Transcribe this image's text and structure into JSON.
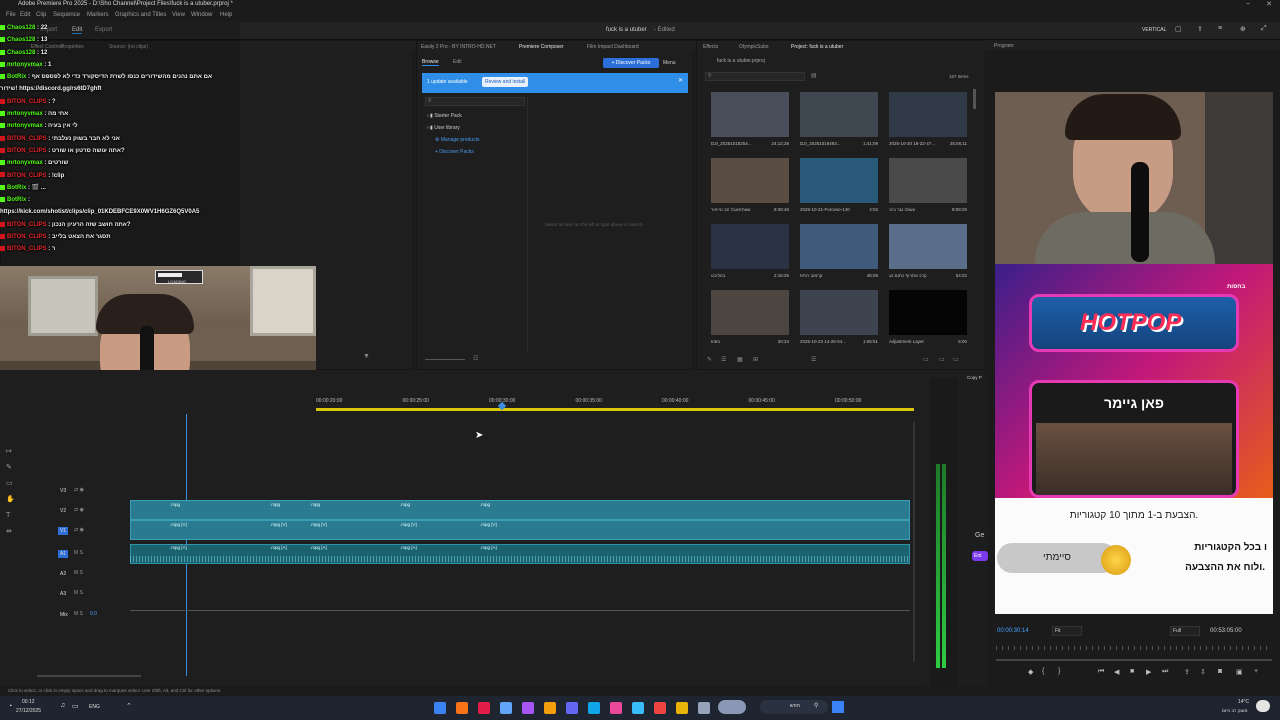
{
  "app": {
    "title_line": "Adobe Premiere Pro 2025 - D:\\Sho Channel\\Project Files\\fuck is a utuber.prproj *",
    "project_title": "fuck is a utuber",
    "edited_status": "- Edited",
    "layout_label": "VERTICAL"
  },
  "menu": [
    "File",
    "Edit",
    "Clip",
    "Sequence",
    "Markers",
    "Graphics and Titles",
    "View",
    "Window",
    "Help"
  ],
  "workspace_tabs": [
    "Import",
    "Edit",
    "Export"
  ],
  "source_panel": {
    "tabs": [
      "Effect Controls",
      "Properties",
      "Source: (no clips)"
    ],
    "clip_state": "(no clip selected)"
  },
  "premiere_composer": {
    "tabs": [
      "Easily 2 Pro - BY INTRO-HD.NET",
      "Premiere Composer",
      "Film Impact Dashboard"
    ],
    "sub_tabs": [
      "Browse",
      "Edit"
    ],
    "discover_button": "+ Discover Packs",
    "menu_button": "Menu",
    "update_text": "1 update available",
    "review_button": "Review and install",
    "tree": [
      "Starter Pack",
      "User library",
      "Manage products",
      "+ Discover Packs"
    ],
    "empty_hint": "Select an item on the left or type above to search"
  },
  "project_panel": {
    "tabs": [
      "Effects",
      "OlympicSubs",
      "Project: fuck is a utuber"
    ],
    "file": "fuck is a utuber.prproj",
    "items_count": "167 items",
    "items": [
      {
        "name": "DJI_20251018254...",
        "dur": "24;12;28"
      },
      {
        "name": "DJI_20251018493...",
        "dur": "1;41;09"
      },
      {
        "name": "2025-10-20 18-22-47...",
        "dur": "25;56;11"
      },
      {
        "name": "עשתחאבל הב ונייחור",
        "dur": "8:36:46"
      },
      {
        "name": "2025-10-21-Forcese-140...",
        "dur": "4:02"
      },
      {
        "name": "עשולו גגר ביגי",
        "dur": "8:08:25"
      },
      {
        "name": "בזוליבט",
        "dur": "2:16:26"
      },
      {
        "name": "קרמוב רוחפ",
        "dur": "48:09"
      },
      {
        "name": "קרב אתרוף כתום נע",
        "dur": "54:22"
      },
      {
        "name": "Intro",
        "dur": "30:34"
      },
      {
        "name": "2025-10-23 14-26-54...",
        "dur": "1:05:51"
      },
      {
        "name": "Adjustment Layer",
        "dur": "5:00"
      }
    ]
  },
  "chat": [
    {
      "user": "Chaos128",
      "msg": " : 22",
      "red": false
    },
    {
      "user": "Chaos128",
      "msg": " : 13",
      "red": false
    },
    {
      "user": "Chaos128",
      "msg": " : 12",
      "red": false
    },
    {
      "user": "mrtonyvmax",
      "msg": " : 1",
      "red": false
    },
    {
      "user": "BotRix",
      "msg": " : אם אתם נהנים מהשידורים כנסו לשרת הדיסקורד כדי לא לפספס אף",
      "red": false
    },
    {
      "user": "",
      "msg": "שידור! https://discord.gg/rs6tD7ghft",
      "red": false
    },
    {
      "user": "BITON_CLIPS",
      "msg": " : ?",
      "red": true
    },
    {
      "user": "mrtonyvmax",
      "msg": " : אחי מה",
      "red": false
    },
    {
      "user": "mrtonyvmax",
      "msg": " : לי אין בעיה",
      "red": false
    },
    {
      "user": "BITON_CLIPS",
      "msg": " : אני לא חבר בשוק נעלבתי",
      "red": true
    },
    {
      "user": "BITON_CLIPS",
      "msg": " : אתה עושה סרטון או שורט?",
      "red": true
    },
    {
      "user": "mrtonyvmax",
      "msg": " : שורטים",
      "red": false
    },
    {
      "user": "BITON_CLIPS",
      "msg": " : !clip",
      "red": true
    },
    {
      "user": "BotRix",
      "msg": " : 🎬 ...",
      "red": false
    },
    {
      "user": "BotRix",
      "msg": " :",
      "red": false
    },
    {
      "user": "",
      "msg": "https://kick.com/shotist/clips/clip_01KDEBFCE9X0WV1H6GZ6Q5V0A5",
      "red": false
    },
    {
      "user": "BITON_CLIPS",
      "msg": " : אתה חושב שזה הרעיון הנכון?",
      "red": true
    },
    {
      "user": "BITON_CLIPS",
      "msg": " : תסגר את הצאט בלייב",
      "red": true
    },
    {
      "user": "BITON_CLIPS",
      "msg": " : ר",
      "red": true
    }
  ],
  "webcam": {
    "loading": "LOADING"
  },
  "timeline": {
    "ruler": [
      "00:00:20:00",
      "00:00:25:00",
      "00:00:30:00",
      "00:00:35:00",
      "00:00:40:00",
      "00:00:45:00",
      "00:00:50:00"
    ],
    "tracks": [
      {
        "name": "V3"
      },
      {
        "name": "V2"
      },
      {
        "name": "V1"
      },
      {
        "name": "A1"
      },
      {
        "name": "A2"
      },
      {
        "name": "A3"
      },
      {
        "name": "Mix",
        "value": "0.0"
      }
    ],
    "clip_label_mpg": ".mpg",
    "clip_label_v": ".mpg [V]",
    "clip_label_a": ".mpg [A]"
  },
  "program": {
    "title": "Program:",
    "timecode": "00:00:30:14",
    "fit": "Fit",
    "quality": "Full",
    "duration": "00:53:05:00",
    "ad_badge": "בחסות",
    "ad_brand": "HOTPOP",
    "ad_title": "פאן גיימר",
    "ad_line1": "הצבעת ב-1 מתוך 10 קטגוריות.",
    "ad_line2": "ו בכל הקטגוריות",
    "ad_line3": "ולוח את ההצבעה.",
    "ad_button": "סיימתי"
  },
  "side_labels": {
    "copy": "Copy P",
    "ge": "Ge",
    "ent": "Ent"
  },
  "status_hint": "Click to select, or click in empty space and drag to marquee select. Use Shift, Alt, and Ctrl for other options.",
  "taskbar": {
    "time": "00:12",
    "date": "27/12/2025",
    "lang": "ENG",
    "search": "חפש",
    "weather_temp": "14°C",
    "weather_desc": "מעונן רב היום",
    "colors": [
      "#3b82f6",
      "#f97316",
      "#e11d48",
      "#60a5fa",
      "#a855f7",
      "#f59e0b",
      "#6366f1",
      "#0ea5e9",
      "#ec4899",
      "#38bdf8",
      "#ef4444",
      "#eab308",
      "#94a3b8",
      "#0284c7"
    ]
  },
  "colors": {
    "accent": "#2d8ceb",
    "clip": "#2a7a90",
    "playhead": "#3b8de0",
    "kick_green": "#53fc18",
    "red_user": "#e2262b"
  }
}
